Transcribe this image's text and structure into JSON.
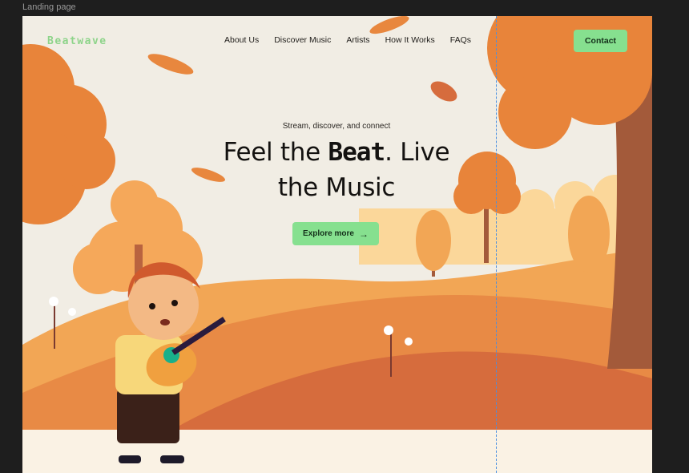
{
  "frame": {
    "label": "Landing page"
  },
  "nav": {
    "logo": "Beatwave",
    "links": [
      "About Us",
      "Discover Music",
      "Artists",
      "How It Works",
      "FAQs"
    ],
    "contact_label": "Contact"
  },
  "hero": {
    "eyebrow": "Stream, discover, and connect",
    "headline_pre": "Feel the ",
    "headline_accent": "Beat",
    "headline_post_1": ". Live",
    "headline_post_2": "the Music",
    "cta_label": "Explore more",
    "cta_icon": "arrow-right-icon"
  },
  "colors": {
    "accent_green": "#86e08f",
    "sky": "#f1ede4",
    "orange_light": "#f5a85a",
    "orange_mid": "#e8873e",
    "orange_dark": "#d3683a",
    "ground": "#faf2e4",
    "trunk": "#a35a3a"
  }
}
